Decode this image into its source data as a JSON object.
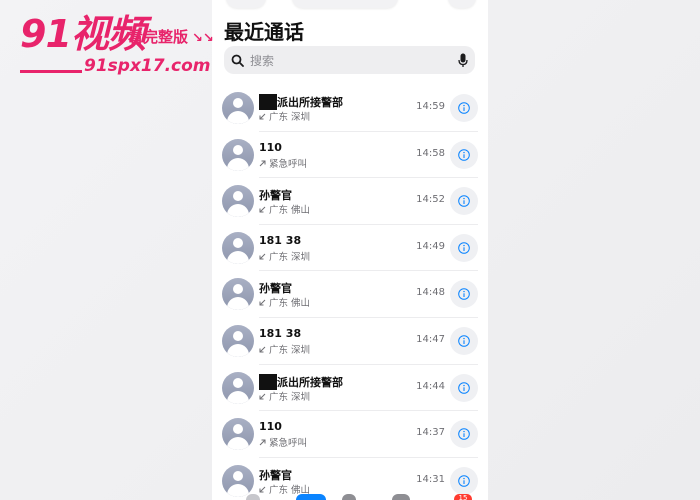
{
  "watermark": {
    "brand": "91视频",
    "tagline": "看完整版",
    "tagline_arrows": "↘↘",
    "url": "91spx17.com"
  },
  "header": {
    "title": "最近通话"
  },
  "search": {
    "placeholder": "搜索"
  },
  "calls": [
    {
      "name": "派出所接警部",
      "redacted_prefix": true,
      "direction": "incoming",
      "subtitle": "广东 深圳",
      "time": "14:59"
    },
    {
      "name": "110",
      "redacted_prefix": false,
      "direction": "outgoing",
      "subtitle": "紧急呼叫",
      "time": "14:58"
    },
    {
      "name": "孙警官",
      "redacted_prefix": false,
      "direction": "incoming",
      "subtitle": "广东 佛山",
      "time": "14:52"
    },
    {
      "name": "181 38",
      "redacted_prefix": false,
      "direction": "incoming",
      "subtitle": "广东 深圳",
      "time": "14:49"
    },
    {
      "name": "孙警官",
      "redacted_prefix": false,
      "direction": "incoming",
      "subtitle": "广东 佛山",
      "time": "14:48"
    },
    {
      "name": "181 38",
      "redacted_prefix": false,
      "direction": "incoming",
      "subtitle": "广东 深圳",
      "time": "14:47"
    },
    {
      "name": "派出所接警部",
      "redacted_prefix": true,
      "direction": "incoming",
      "subtitle": "广东 深圳",
      "time": "14:44"
    },
    {
      "name": "110",
      "redacted_prefix": false,
      "direction": "outgoing",
      "subtitle": "紧急呼叫",
      "time": "14:37"
    },
    {
      "name": "孙警官",
      "redacted_prefix": false,
      "direction": "incoming",
      "subtitle": "广东 佛山",
      "time": "14:31"
    }
  ],
  "icons": {
    "search": "search-icon",
    "mic": "microphone-icon",
    "info": "info-icon",
    "incoming": "incoming-call-arrow-icon",
    "outgoing": "outgoing-call-arrow-icon",
    "avatar": "contact-avatar-icon"
  },
  "colors": {
    "watermark": "#e8246b",
    "accent": "#0a84ff",
    "secondary_text": "#6e6e73"
  },
  "tabbar": {
    "badge": "15"
  }
}
